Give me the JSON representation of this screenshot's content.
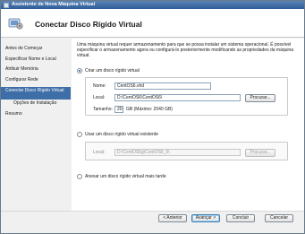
{
  "window": {
    "title": "Assistente de Nova Máquina Virtual"
  },
  "header": {
    "title": "Conectar Disco Rígido Virtual",
    "icon": "wizard-icon"
  },
  "sidebar": {
    "items": [
      {
        "label": "Antes de Começar"
      },
      {
        "label": "Especificar Nome e Local"
      },
      {
        "label": "Atribuir Memória"
      },
      {
        "label": "Configurar Rede"
      },
      {
        "label": "Conectar Disco Rígido Virtual",
        "active": true
      },
      {
        "label": "Opções de Instalação"
      },
      {
        "label": "Resumo"
      }
    ]
  },
  "main": {
    "intro": "Uma máquina virtual requer armazenamento para que se possa instalar um sistema operacional. É possível especificar o armazenamento agora ou configurá-lo posteriormente modificando as propriedades da máquina virtual.",
    "create": {
      "label": "Criar um disco rígido virtual",
      "checked": true,
      "name_label": "Nome:",
      "name_value": "CentOS6.vhd",
      "location_label": "Local:",
      "location_value": "D:\\CentOS6\\CentOS6\\",
      "browse_label": "Procurar...",
      "size_label": "Tamanho:",
      "size_value": "20",
      "size_unit": "GB (Máximo: 2040 GB)"
    },
    "existing": {
      "label": "Usar um disco rígido virtual existente",
      "checked": false,
      "location_label": "Local:",
      "location_value": "D:\\CentOS6g\\CentOS6_0\\",
      "browse_label": "Procurar..."
    },
    "later": {
      "label": "Anexar um disco rígido virtual mais tarde",
      "checked": false
    }
  },
  "footer": {
    "back_label": "< Anterior",
    "next_label": "Avançar >",
    "finish_label": "Concluir",
    "cancel_label": "Cancelar"
  },
  "colors": {
    "accent": "#3d6ea8",
    "titlebar": "#2e5d96"
  }
}
